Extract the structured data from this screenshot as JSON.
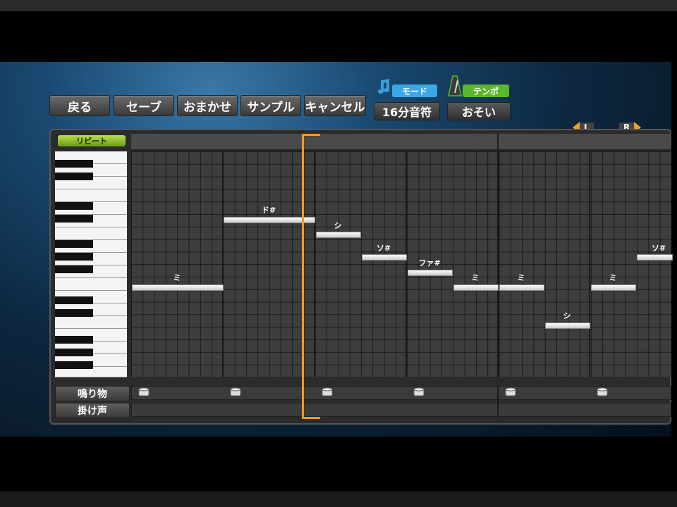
{
  "toolbar": {
    "back": "戻る",
    "save": "セーブ",
    "auto": "おまかせ",
    "sample": "サンプル",
    "cancel": "キャンセル"
  },
  "mode": {
    "tag": "モード",
    "value": "16分音符"
  },
  "tempo": {
    "tag": "テンポ",
    "value": "おそい"
  },
  "scroll": {
    "left": "L",
    "right": "R"
  },
  "repeat_label": "リピート",
  "notes": [
    {
      "label": "ミ"
    },
    {
      "label": "ド#"
    },
    {
      "label": "シ"
    },
    {
      "label": "ソ#"
    },
    {
      "label": "ファ#"
    },
    {
      "label": "ミ"
    },
    {
      "label": "ミ"
    },
    {
      "label": "シ"
    },
    {
      "label": "ミ"
    },
    {
      "label": "ソ#"
    }
  ],
  "lanes": {
    "percussion": "鳴り物",
    "shout": "掛け声"
  },
  "colors": {
    "accent": "#f39a1c",
    "mode_tag": "#3aa8e8",
    "tempo_tag": "#5ab82a"
  }
}
